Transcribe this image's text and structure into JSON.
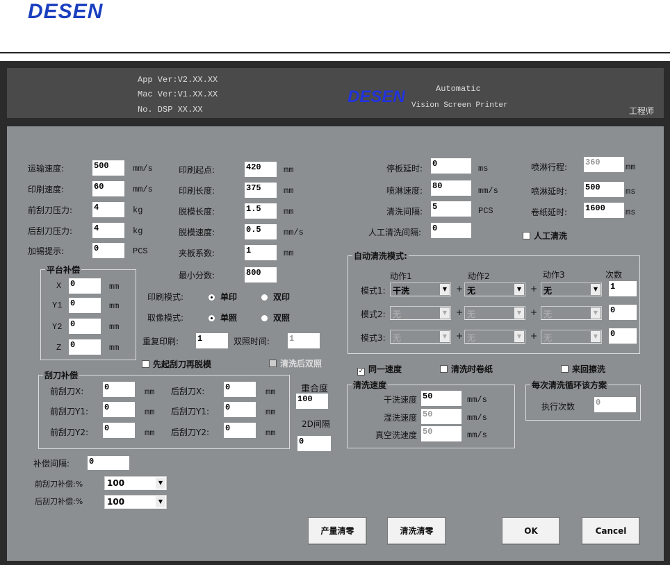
{
  "brand": "DESEN",
  "header": {
    "app_ver": "App Ver:V2.XX.XX",
    "mac_ver": "Mac Ver:V1.XX.XX",
    "dsp": "No. DSP XX.XX",
    "logo": "DESEN",
    "product1": "Automatic",
    "product2": "Vision Screen Printer",
    "role": "工程师"
  },
  "left": {
    "transport_speed": {
      "label": "运输速度:",
      "value": "500",
      "unit": "mm/s"
    },
    "print_speed": {
      "label": "印刷速度:",
      "value": "60",
      "unit": "mm/s"
    },
    "front_pressure": {
      "label": "前刮刀压力:",
      "value": "4",
      "unit": "kg"
    },
    "rear_pressure": {
      "label": "后刮刀压力:",
      "value": "4",
      "unit": "kg"
    },
    "tin_hint": {
      "label": "加锡提示:",
      "value": "0",
      "unit": "PCS"
    },
    "print_start": {
      "label": "印刷起点:",
      "value": "420",
      "unit": "mm"
    },
    "print_length": {
      "label": "印刷长度:",
      "value": "375",
      "unit": "mm"
    },
    "demold_length": {
      "label": "脱模长度:",
      "value": "1.5",
      "unit": "mm"
    },
    "demold_speed": {
      "label": "脱模速度:",
      "value": "0.5",
      "unit": "mm/s"
    },
    "clamp_coef": {
      "label": "夹板系数:",
      "value": "1",
      "unit": "mm"
    },
    "min_score": {
      "label": "最小分数:",
      "value": "800"
    }
  },
  "platform": {
    "title": "平台补偿",
    "rows": [
      {
        "label": "X",
        "value": "0",
        "unit": "mm"
      },
      {
        "label": "Y1",
        "value": "0",
        "unit": "mm"
      },
      {
        "label": "Y2",
        "value": "0",
        "unit": "mm"
      },
      {
        "label": "Z",
        "value": "0",
        "unit": "mm"
      }
    ]
  },
  "print_mode": {
    "label": "印刷模式:",
    "opt1": "单印",
    "opt2": "双印"
  },
  "image_mode": {
    "label": "取像模式:",
    "opt1": "单照",
    "opt2": "双照"
  },
  "repeat_print": {
    "label": "重复印刷:",
    "value": "1"
  },
  "double_time": {
    "label": "双照时间:",
    "value": "1"
  },
  "chk_lift_first": "先起刮刀再脱模",
  "chk_clean_double": "清洗后双照",
  "blade": {
    "title": "刮刀补偿",
    "rows": [
      {
        "l1": "前刮刀X:",
        "v1": "0",
        "l2": "后刮刀X:",
        "v2": "0",
        "unit": "mm"
      },
      {
        "l1": "前刮刀Y1:",
        "v1": "0",
        "l2": "后刮刀Y1:",
        "v2": "0",
        "unit": "mm"
      },
      {
        "l1": "前刮刀Y2:",
        "v1": "0",
        "l2": "后刮刀Y2:",
        "v2": "0",
        "unit": "mm"
      }
    ]
  },
  "overlap": {
    "label": "重合度",
    "value": "100"
  },
  "gap2d": {
    "label": "2D间隔",
    "value": "0"
  },
  "comp_interval": {
    "label": "补偿间隔:",
    "value": "0"
  },
  "front_comp": {
    "label": "前刮刀补偿:%",
    "value": "100"
  },
  "rear_comp": {
    "label": "后刮刀补偿:%",
    "value": "100"
  },
  "right": {
    "stop_delay": {
      "label": "停板延时:",
      "value": "0",
      "unit": "ms"
    },
    "spray_speed": {
      "label": "喷淋速度:",
      "value": "80",
      "unit": "mm/s"
    },
    "clean_interval": {
      "label": "清洗间隔:",
      "value": "5",
      "unit": "PCS"
    },
    "manual_interval": {
      "label": "人工清洗间隔:",
      "value": "0"
    },
    "spray_travel": {
      "label": "喷淋行程:",
      "value": "360",
      "unit": "mm"
    },
    "spray_delay": {
      "label": "喷淋延时:",
      "value": "500",
      "unit": "ms"
    },
    "roll_delay": {
      "label": "卷纸延时:",
      "value": "1600",
      "unit": "ms"
    },
    "manual_clean": "人工清洗"
  },
  "auto_clean": {
    "title": "自动清洗模式:",
    "cols": [
      "动作1",
      "动作2",
      "动作3",
      "次数"
    ],
    "modes": [
      {
        "label": "模式1:",
        "a1": "干洗",
        "a2": "无",
        "a3": "无",
        "count": "1"
      },
      {
        "label": "模式2:",
        "a1": "无",
        "a2": "无",
        "a3": "无",
        "count": "0"
      },
      {
        "label": "模式3:",
        "a1": "无",
        "a2": "无",
        "a3": "无",
        "count": "0"
      }
    ],
    "plus": "+"
  },
  "chk_same_speed": "同一速度",
  "chk_roll_on_clean": "清洗时卷纸",
  "chk_back_forth": "来回擦洗",
  "clean_speed": {
    "title": "清洗速度",
    "dry": {
      "label": "干洗速度",
      "value": "50",
      "unit": "mm/s"
    },
    "wet": {
      "label": "湿洗速度",
      "value": "50",
      "unit": "mm/s"
    },
    "vac": {
      "label": "真空洗速度",
      "value": "50",
      "unit": "mm/s"
    }
  },
  "cycle": {
    "title": "每次清洗循环该方案",
    "label": "执行次数",
    "value": "0"
  },
  "buttons": {
    "reset_output": "产量清零",
    "reset_clean": "清洗清零",
    "ok": "OK",
    "cancel": "Cancel"
  }
}
